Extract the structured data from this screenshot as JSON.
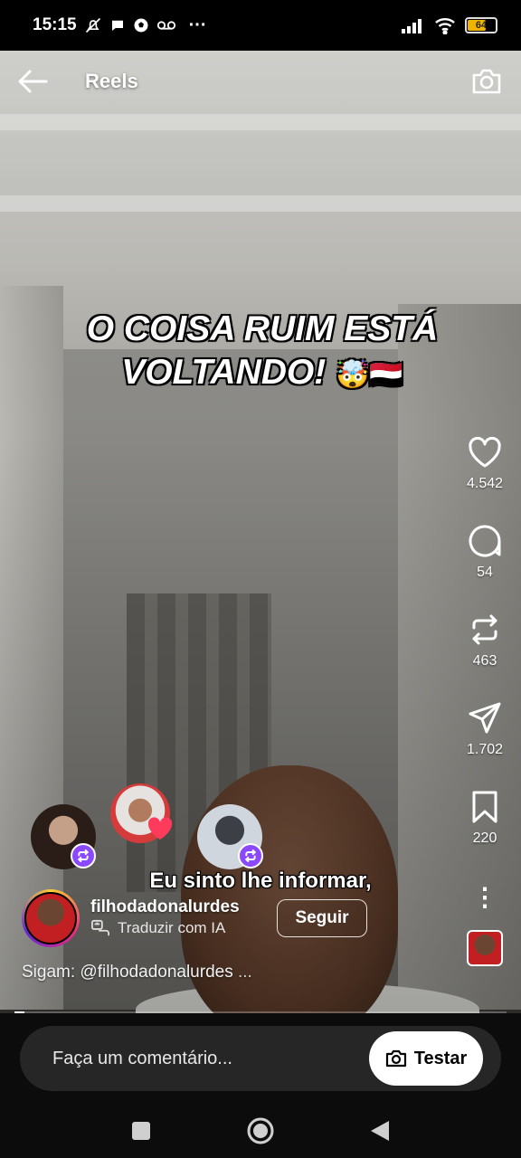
{
  "status_bar": {
    "time": "15:15",
    "battery": "64",
    "more": "···"
  },
  "header": {
    "title": "Reels",
    "back_icon": "arrow-left-icon",
    "camera_icon": "camera-icon"
  },
  "video": {
    "headline_line1": "O COISA RUIM ESTÁ",
    "headline_line2": "VOLTANDO!",
    "headline_emoji": "🤯🇾🇪",
    "subtitle": "Eu sinto lhe informar,",
    "progress": 0.02
  },
  "actions": {
    "likes": "4.542",
    "comments": "54",
    "reposts": "463",
    "shares": "1.702",
    "saves": "220",
    "more": "⋮"
  },
  "profile": {
    "username": "filhodadonalurdes",
    "translate": "Traduzir com IA",
    "follow": "Seguir",
    "caption": "Sigam: @filhodadonalurdes",
    "caption_more": "..."
  },
  "comment_bar": {
    "placeholder": "Faça um comentário...",
    "test_button": "Testar"
  },
  "colors": {
    "repost_badge": "#8a49ff",
    "heart": "#ff3b5c",
    "battery": "#f0b400"
  }
}
